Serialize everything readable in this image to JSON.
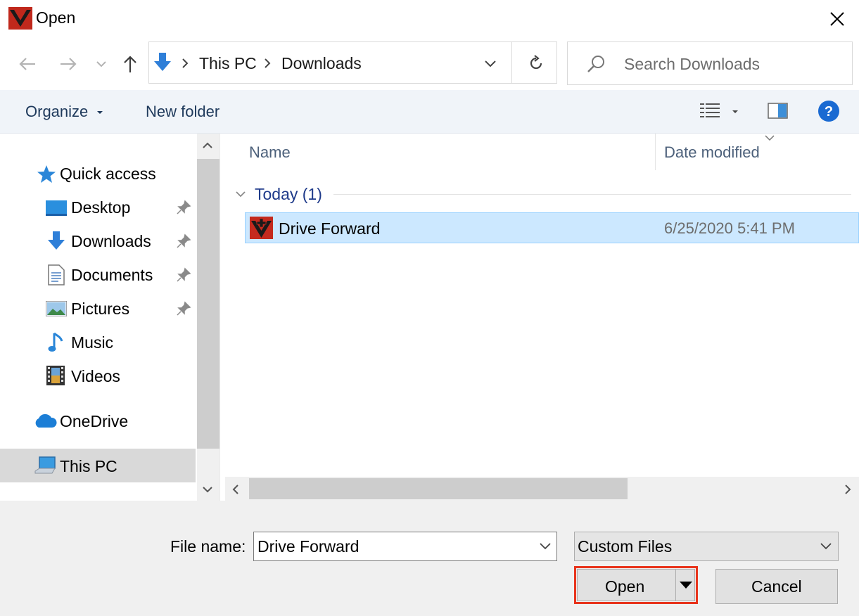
{
  "window": {
    "title": "Open",
    "app_icon": "app-logo-icon"
  },
  "nav": {
    "back_icon": "arrow-left-icon",
    "forward_icon": "arrow-right-icon",
    "recent_icon": "chevron-down-icon",
    "up_icon": "arrow-up-icon",
    "breadcrumb": [
      "This PC",
      "Downloads"
    ],
    "refresh_icon": "refresh-icon",
    "search_placeholder": "Search Downloads"
  },
  "toolbar": {
    "organize_label": "Organize",
    "new_folder_label": "New folder"
  },
  "sidebar": {
    "quick_access_label": "Quick access",
    "items": [
      {
        "label": "Desktop",
        "pinned": true
      },
      {
        "label": "Downloads",
        "pinned": true
      },
      {
        "label": "Documents",
        "pinned": true
      },
      {
        "label": "Pictures",
        "pinned": true
      },
      {
        "label": "Music",
        "pinned": false
      },
      {
        "label": "Videos",
        "pinned": false
      }
    ],
    "onedrive_label": "OneDrive",
    "this_pc_label": "This PC"
  },
  "filelist": {
    "columns": {
      "name": "Name",
      "date": "Date modified"
    },
    "group_label": "Today (1)",
    "files": [
      {
        "name": "Drive Forward",
        "date": "6/25/2020 5:41 PM",
        "selected": true
      }
    ]
  },
  "footer": {
    "filename_label": "File name:",
    "filename_value": "Drive Forward",
    "filetype_value": "Custom Files",
    "open_label": "Open",
    "cancel_label": "Cancel"
  },
  "colors": {
    "accent": "#0078d7",
    "selection": "#cce8ff",
    "highlight_outline": "#e8341c"
  }
}
